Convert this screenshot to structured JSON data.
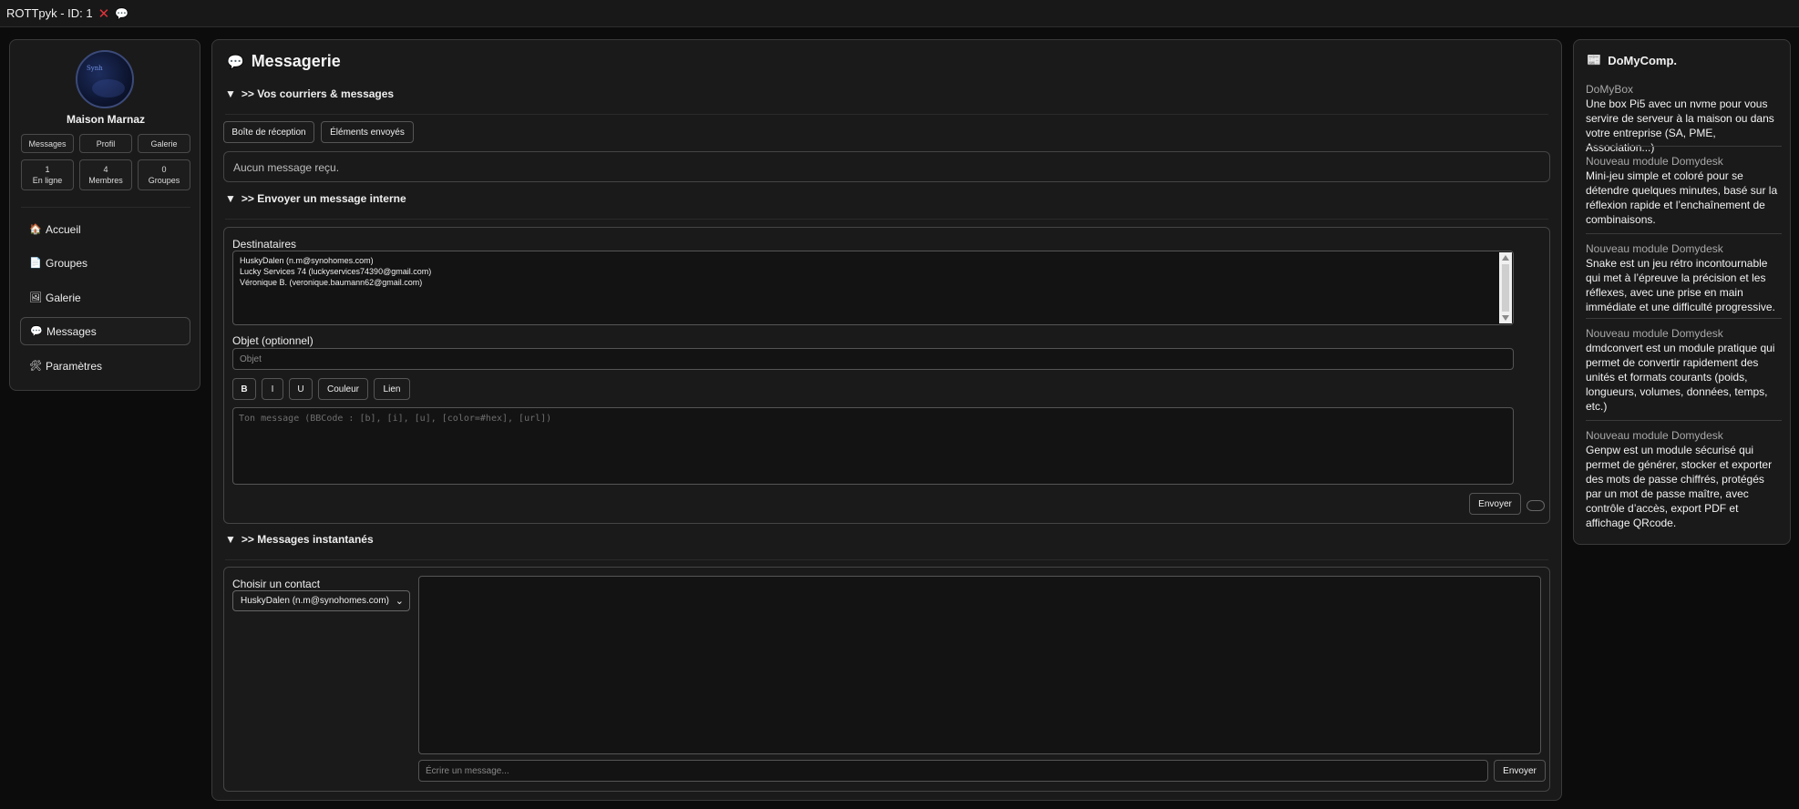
{
  "topbar": {
    "title": "ROTTpyk - ID: 1",
    "close_glyph": "✕",
    "bubble_glyph": "💬"
  },
  "sidebar": {
    "avatar_text": "Synh",
    "house_name": "Maison Marnaz",
    "buttons": [
      "Messages",
      "Profil",
      "Galerie"
    ],
    "stats": [
      {
        "value": "1",
        "label": "En ligne"
      },
      {
        "value": "4",
        "label": "Membres"
      },
      {
        "value": "0",
        "label": "Groupes"
      }
    ],
    "nav": [
      {
        "icon": "🏠",
        "label": "Accueil"
      },
      {
        "icon": "📄",
        "label": "Groupes"
      },
      {
        "icon": "🖼",
        "label": "Galerie"
      },
      {
        "icon": "💬",
        "label": "Messages"
      },
      {
        "icon": "🛠",
        "label": "Paramètres"
      }
    ]
  },
  "main": {
    "title_icon": "💬",
    "title": "Messagerie",
    "sections": {
      "mail": ">> Vos courriers & messages",
      "send": ">> Envoyer un message interne",
      "instant": ">> Messages instantanés"
    },
    "mail_tabs": [
      "Boîte de réception",
      "Éléments envoyés"
    ],
    "empty_inbox": "Aucun message reçu.",
    "recipients_label": "Destinataires",
    "recipients": [
      "HuskyDalen (n.m@synohomes.com)",
      "Lucky Services 74 (luckyservices74390@gmail.com)",
      "Véronique B. (veronique.baumann62@gmail.com)"
    ],
    "subject_label": "Objet (optionnel)",
    "subject_placeholder": "Objet",
    "format_buttons": [
      "B",
      "I",
      "U",
      "Couleur",
      "Lien"
    ],
    "message_placeholder": "Ton message (BBCode : [b], [i], [u], [color=#hex], [url])",
    "send_label": "Envoyer",
    "contact_label": "Choisir un contact",
    "contact_selected": "HuskyDalen (n.m@synohomes.com)",
    "chat_placeholder": "Écrire un message...",
    "chat_send_label": "Envoyer"
  },
  "right": {
    "title_icon": "📰",
    "title": "DoMyComp.",
    "news": [
      {
        "heading": "DoMyBox",
        "body": "Une box Pi5 avec un nvme pour vous servire de serveur à la maison ou dans votre entreprise (SA, PME, Association...)"
      },
      {
        "heading": "Nouveau module Domydesk",
        "body": "Mini-jeu simple et coloré pour se détendre quelques minutes, basé sur la réflexion rapide et l’enchaînement de combinaisons."
      },
      {
        "heading": "Nouveau module Domydesk",
        "body": "Snake est un jeu rétro incontournable qui met à l’épreuve la précision et les réflexes, avec une prise en main immédiate et une difficulté progressive."
      },
      {
        "heading": "Nouveau module Domydesk",
        "body": "dmdconvert est un module pratique qui permet de convertir rapidement des unités et formats courants (poids, longueurs, volumes, données, temps, etc.)"
      },
      {
        "heading": "Nouveau module Domydesk",
        "body": "Genpw est un module sécurisé qui permet de générer, stocker et exporter des mots de passe chiffrés, protégés par un mot de passe maître, avec contrôle d’accès, export PDF et affichage QRcode."
      }
    ]
  }
}
